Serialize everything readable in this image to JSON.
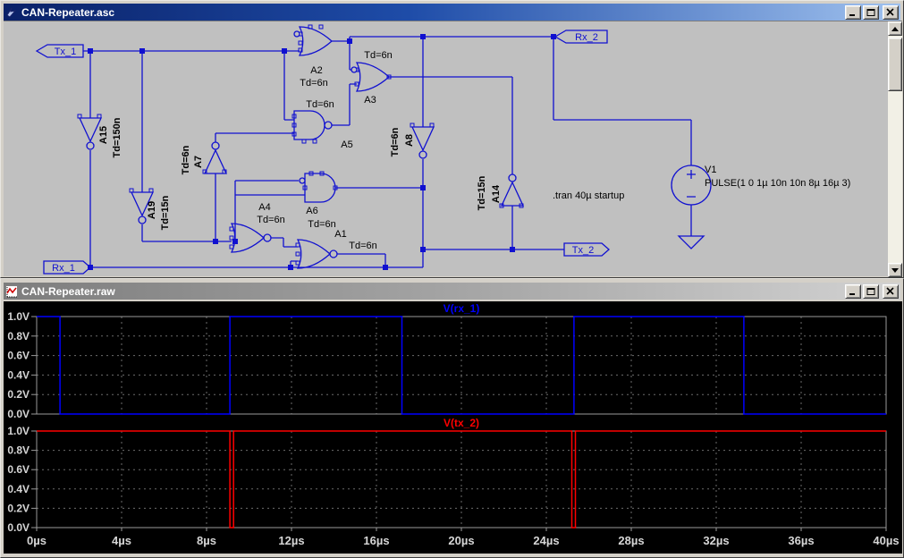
{
  "schematic_window": {
    "title": "CAN-Repeater.asc",
    "flags": {
      "tx1": "Tx_1",
      "rx1": "Rx_1",
      "rx2": "Rx_2",
      "tx2": "Tx_2"
    },
    "components": {
      "a15": {
        "name": "A15",
        "param": "Td=150n"
      },
      "a19": {
        "name": "A19",
        "param": "Td=15n"
      },
      "a7": {
        "name": "A7",
        "param": "Td=6n"
      },
      "a2": {
        "name": "A2",
        "param": "Td=6n"
      },
      "a3": {
        "name": "A3",
        "param": "Td=6n"
      },
      "a5": {
        "name": "A5",
        "param": "Td=6n"
      },
      "a6": {
        "name": "A6",
        "param": "Td=6n"
      },
      "a4": {
        "name": "A4",
        "param": "Td=6n"
      },
      "a1": {
        "name": "A1",
        "param": "Td=6n"
      },
      "a8": {
        "name": "A8",
        "param": "Td=6n"
      },
      "a14": {
        "name": "A14",
        "param": "Td=15n"
      },
      "v1": {
        "name": "V1",
        "param": "PULSE(1 0 1µ 10n 10n 8µ 16µ 3)"
      }
    },
    "directive": ".tran 40µ startup",
    "colors": {
      "wire": "#1010d0",
      "canvas": "#c0c0c0"
    }
  },
  "waveform_window": {
    "title": "CAN-Repeater.raw",
    "colors": {
      "background": "#000000",
      "axis_text": "#d6d6d6",
      "grid": "#6b6b6b"
    }
  },
  "chart_data": [
    {
      "type": "line",
      "title": "V(rx_1)",
      "color": "#0000ff",
      "x_unit": "µs",
      "xlim": [
        0,
        40
      ],
      "ylim": [
        0,
        1
      ],
      "grid": true,
      "legend_position": "top-center",
      "y_ticks": [
        "0.0V",
        "0.2V",
        "0.4V",
        "0.6V",
        "0.8V",
        "1.0V"
      ],
      "x_ticks": [
        "0µs",
        "4µs",
        "8µs",
        "12µs",
        "16µs",
        "20µs",
        "24µs",
        "28µs",
        "32µs",
        "36µs",
        "40µs"
      ],
      "points": [
        [
          0,
          1
        ],
        [
          1.1,
          1
        ],
        [
          1.1,
          0
        ],
        [
          9.1,
          0
        ],
        [
          9.1,
          1
        ],
        [
          17.2,
          1
        ],
        [
          17.2,
          0
        ],
        [
          25.3,
          0
        ],
        [
          25.3,
          1
        ],
        [
          33.3,
          1
        ],
        [
          33.3,
          0
        ],
        [
          40,
          0
        ]
      ]
    },
    {
      "type": "line",
      "title": "V(tx_2)",
      "color": "#ff0000",
      "x_unit": "µs",
      "xlim": [
        0,
        40
      ],
      "ylim": [
        0,
        1
      ],
      "grid": true,
      "legend_position": "top-center",
      "y_ticks": [
        "0.0V",
        "0.2V",
        "0.4V",
        "0.6V",
        "0.8V",
        "1.0V"
      ],
      "x_ticks": [
        "0µs",
        "4µs",
        "8µs",
        "12µs",
        "16µs",
        "20µs",
        "24µs",
        "28µs",
        "32µs",
        "36µs",
        "40µs"
      ],
      "points": [
        [
          0,
          1
        ],
        [
          9.1,
          1
        ],
        [
          9.1,
          0
        ],
        [
          9.27,
          0
        ],
        [
          9.27,
          1
        ],
        [
          25.2,
          1
        ],
        [
          25.2,
          0
        ],
        [
          25.37,
          0
        ],
        [
          25.37,
          1
        ],
        [
          40,
          1
        ]
      ]
    }
  ]
}
